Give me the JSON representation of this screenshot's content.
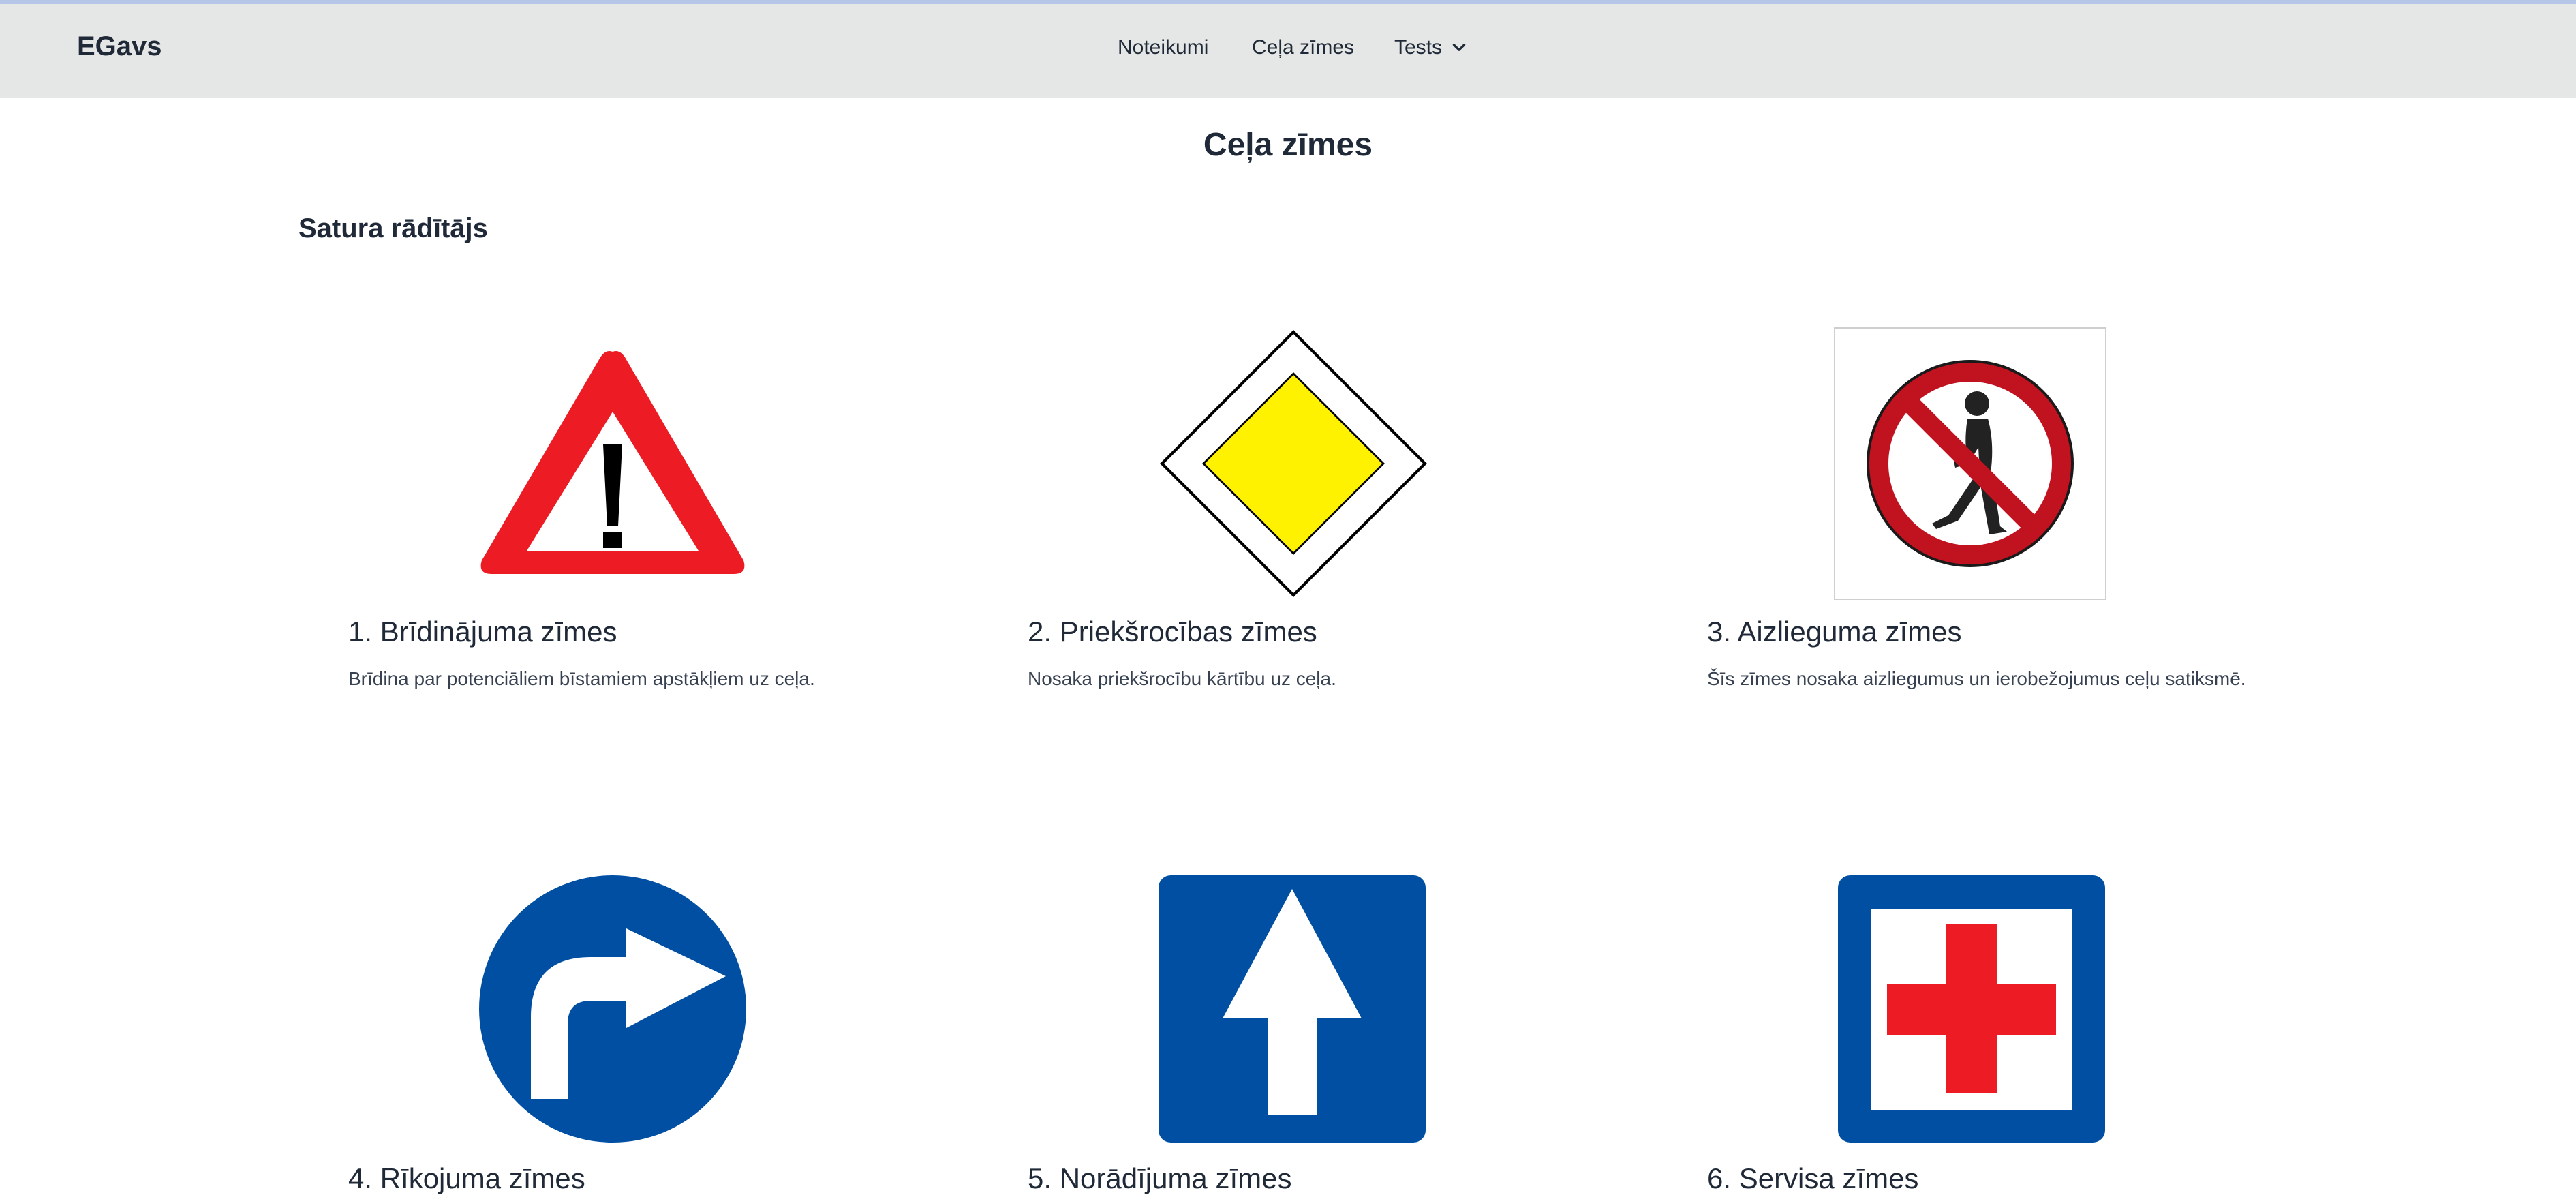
{
  "brand": "EGavs",
  "nav": {
    "rules": "Noteikumi",
    "signs": "Ceļa zīmes",
    "tests": "Tests"
  },
  "page_title": "Ceļa zīmes",
  "toc_title": "Satura rādītājs",
  "colors": {
    "navbar_bg": "#e5e7e6",
    "warning_red": "#ed1c24",
    "priority_yellow": "#fff200",
    "prohibition_red": "#c1121f",
    "sign_blue": "#004fa3"
  },
  "categories": [
    {
      "title": "1. Brīdinājuma zīmes",
      "description": "Brīdina par potenciāliem bīstamiem apstākļiem uz ceļa.",
      "icon": "warning-sign-icon"
    },
    {
      "title": "2. Priekšrocības zīmes",
      "description": "Nosaka priekšrocību kārtību uz ceļa.",
      "icon": "priority-sign-icon"
    },
    {
      "title": "3. Aizlieguma zīmes",
      "description": "Šīs zīmes nosaka aizliegumus un ierobežojumus ceļu satiksmē.",
      "icon": "prohibition-sign-icon"
    },
    {
      "title": "4. Rīkojuma zīmes",
      "description": "",
      "icon": "mandatory-sign-icon"
    },
    {
      "title": "5. Norādījuma zīmes",
      "description": "",
      "icon": "information-sign-icon"
    },
    {
      "title": "6. Servisa zīmes",
      "description": "",
      "icon": "service-sign-icon"
    }
  ]
}
